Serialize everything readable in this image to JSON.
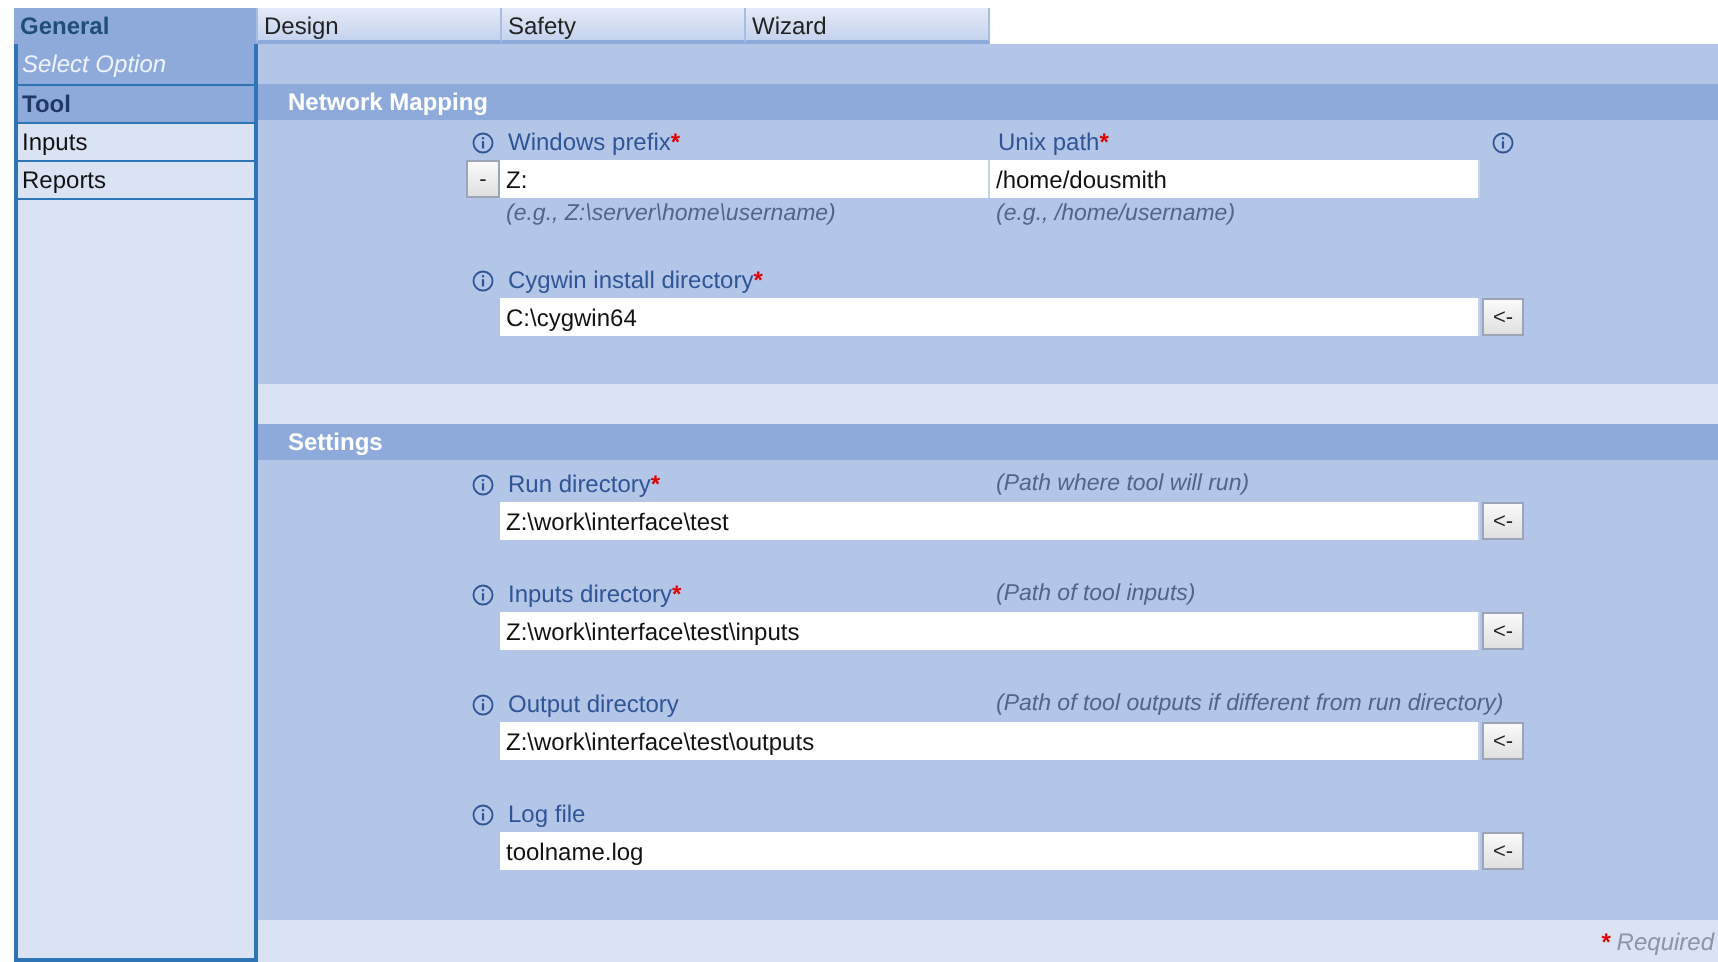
{
  "tabs": [
    {
      "label": "General",
      "selected": true
    },
    {
      "label": "Design",
      "selected": false
    },
    {
      "label": "Safety",
      "selected": false
    },
    {
      "label": "Wizard",
      "selected": false
    }
  ],
  "sidebar": {
    "header": "Select Option",
    "items": [
      {
        "label": "Tool",
        "selected": true
      },
      {
        "label": "Inputs",
        "selected": false
      },
      {
        "label": "Reports",
        "selected": false
      }
    ]
  },
  "sections": [
    {
      "title": "Network Mapping",
      "fields": [
        {
          "kind": "pair",
          "button": "-",
          "left": {
            "label": "Windows prefix",
            "required_mark": "*",
            "value": "Z:",
            "example": "(e.g., Z:\\server\\home\\username)"
          },
          "right": {
            "label": "Unix path",
            "required_mark": "*",
            "value": "/home/dousmith",
            "example": "(e.g., /home/username)"
          }
        },
        {
          "kind": "path",
          "label": "Cygwin install directory",
          "required_mark": "*",
          "value": "C:\\cygwin64",
          "button": "<-"
        }
      ]
    },
    {
      "title": "Settings",
      "fields": [
        {
          "kind": "path",
          "label": "Run directory",
          "required_mark": "*",
          "hint": "(Path where tool will run)",
          "value": "Z:\\work\\interface\\test",
          "button": "<-"
        },
        {
          "kind": "path",
          "label": "Inputs directory",
          "required_mark": "*",
          "hint": "(Path of tool inputs)",
          "value": "Z:\\work\\interface\\test\\inputs",
          "button": "<-"
        },
        {
          "kind": "path",
          "label": "Output directory",
          "hint": "(Path of tool outputs if different from run directory)",
          "value": "Z:\\work\\interface\\test\\outputs",
          "button": "<-"
        },
        {
          "kind": "path",
          "label": "Log file",
          "value": "toolname.log",
          "button": "<-"
        }
      ]
    }
  ],
  "footer": {
    "mark": "*",
    "text": "Required"
  }
}
